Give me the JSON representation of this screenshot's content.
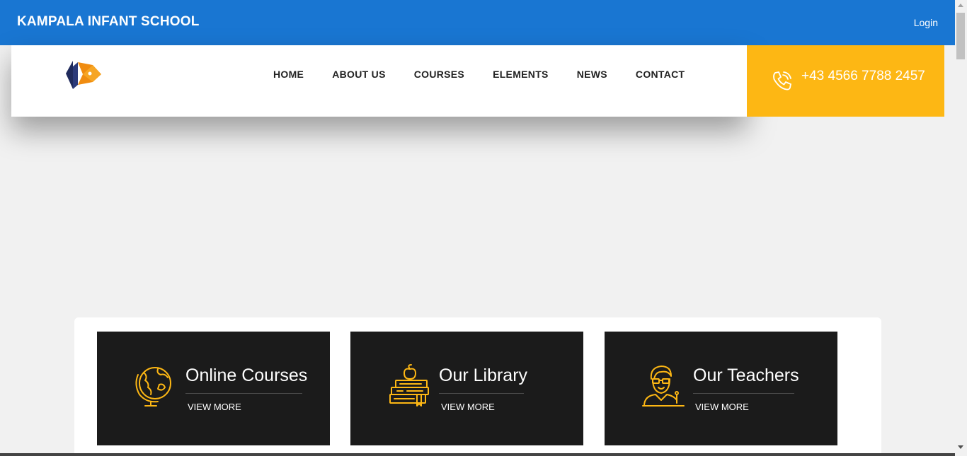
{
  "topbar": {
    "brand": "KAMPALA INFANT SCHOOL",
    "login_label": "Login",
    "bg_color": "#1976d2"
  },
  "header": {
    "logo_icon": "pen-nib-logo-icon",
    "nav": [
      {
        "label": "HOME"
      },
      {
        "label": "ABOUT US"
      },
      {
        "label": "COURSES"
      },
      {
        "label": "ELEMENTS"
      },
      {
        "label": "NEWS"
      },
      {
        "label": "CONTACT"
      }
    ],
    "phone": {
      "icon": "phone-icon",
      "number": "+43 4566 7788 2457",
      "bg_color": "#fdb714"
    }
  },
  "features": [
    {
      "title": "Online Courses",
      "link": "VIEW MORE",
      "icon": "globe-icon"
    },
    {
      "title": "Our Library",
      "link": "VIEW MORE",
      "icon": "books-icon"
    },
    {
      "title": "Our Teachers",
      "link": "VIEW MORE",
      "icon": "teacher-icon"
    }
  ],
  "colors": {
    "accent": "#fdb714",
    "card_dark": "#1b1b1b",
    "page_bg": "#f1f1f1"
  }
}
